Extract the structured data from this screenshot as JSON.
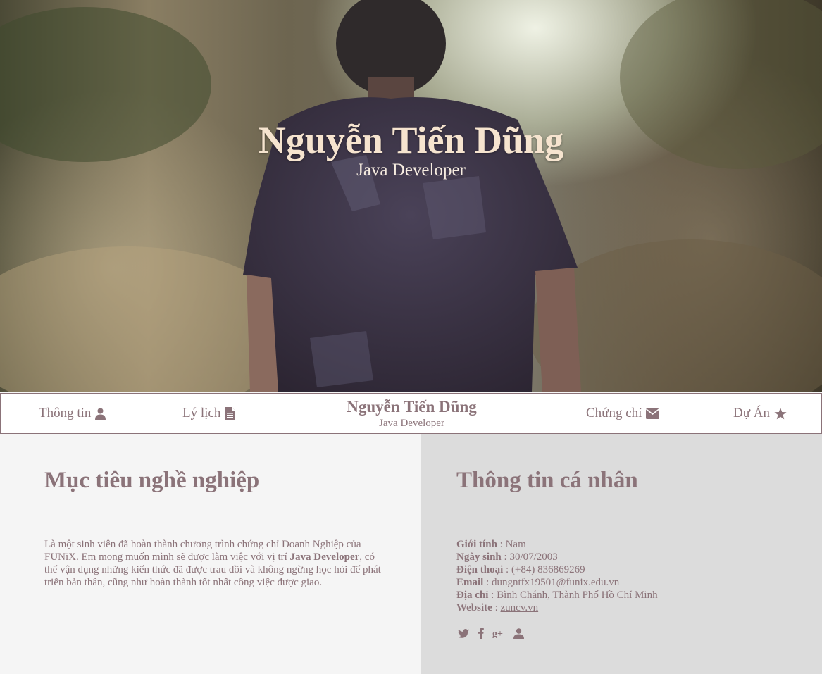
{
  "hero": {
    "name": "Nguyễn Tiến Dũng",
    "job": "Java Developer"
  },
  "nav": {
    "items": [
      {
        "label": "Thông tin",
        "icon": "user-icon"
      },
      {
        "label": "Lý lịch",
        "icon": "file-text-icon"
      },
      {
        "label": "Chứng chỉ",
        "icon": "envelope-icon"
      },
      {
        "label": "Dự Án",
        "icon": "star-icon"
      }
    ],
    "brand_name": "Nguyễn Tiến Dũng",
    "brand_job": "Java Developer"
  },
  "objective": {
    "title": "Mục tiêu nghề nghiệp",
    "text_1": "Là một sinh viên đã hoàn thành chương trình chứng chỉ Doanh Nghiệp của FUNiX. Em mong muốn mình sẽ được làm việc với vị trí ",
    "text_bold": "Java Developer",
    "text_2": ", có thể vận dụng những kiến thức đã được trau dồi và không ngừng học hỏi để phát triển bản thân, cũng như hoàn thành tốt nhất công việc được giao."
  },
  "info": {
    "title": "Thông tin cá nhân",
    "separator": " : ",
    "rows": [
      {
        "label": "Giới tính",
        "value": "Nam"
      },
      {
        "label": "Ngày sinh",
        "value": "30/07/2003"
      },
      {
        "label": "Điện thoại",
        "value": "(+84) 836869269"
      },
      {
        "label": "Email",
        "value": "dungntfx19501@funix.edu.vn"
      },
      {
        "label": "Địa chỉ",
        "value": "Bình Chánh, Thành Phố Hồ Chí Minh"
      },
      {
        "label": "Website",
        "value": "zuncv.vn"
      }
    ],
    "socials": [
      "twitter-icon",
      "facebook-icon",
      "google-plus-icon",
      "user-icon"
    ]
  },
  "colors": {
    "accent": "#8b7379",
    "hero_title": "#f6e4cf",
    "left_bg": "#f5f5f5",
    "right_bg": "#dcdcdc"
  }
}
